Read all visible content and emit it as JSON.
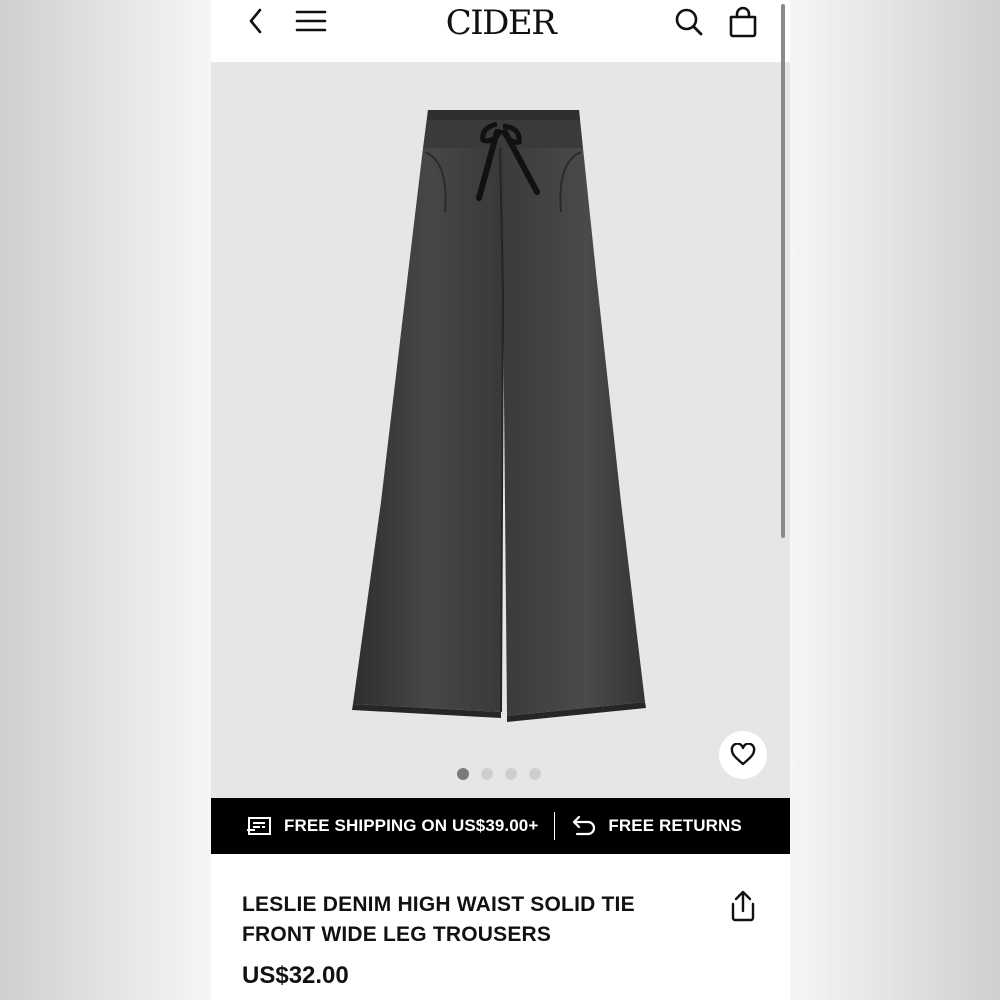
{
  "header": {
    "logo": "CIDER",
    "back_icon": "chevron-left-icon",
    "menu_icon": "hamburger-menu-icon",
    "search_icon": "search-icon",
    "bag_icon": "shopping-bag-icon"
  },
  "gallery": {
    "image_alt": "Black wide leg denim trousers with drawstring waist",
    "total_slides": 4,
    "active_slide": 1,
    "wishlist_icon": "heart-icon"
  },
  "promo": {
    "shipping_icon": "shipping-truck-icon",
    "shipping_label": "FREE SHIPPING ON US$39.00+",
    "returns_icon": "return-arrow-icon",
    "returns_label": "FREE RETURNS"
  },
  "product": {
    "title": "LESLIE DENIM HIGH WAIST SOLID TIE FRONT WIDE LEG TROUSERS",
    "price": "US$32.00",
    "share_icon": "share-icon"
  },
  "colors": {
    "promo_bg": "#000000",
    "gallery_bg": "#e6e6e6",
    "text": "#111111"
  }
}
